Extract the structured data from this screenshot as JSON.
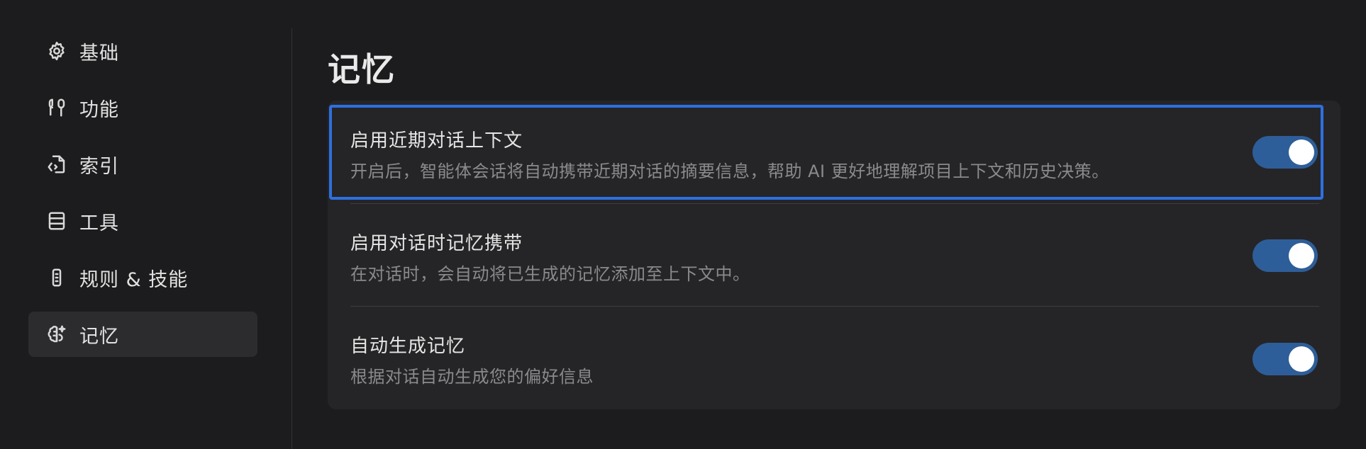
{
  "sidebar": {
    "items": [
      {
        "label": "基础",
        "icon": "gear-icon"
      },
      {
        "label": "功能",
        "icon": "tools-icon"
      },
      {
        "label": "索引",
        "icon": "index-file-icon"
      },
      {
        "label": "工具",
        "icon": "stack-icon"
      },
      {
        "label": "规则 & 技能",
        "icon": "rule-icon"
      },
      {
        "label": "记忆",
        "icon": "brain-sparkle-icon",
        "active": true
      }
    ]
  },
  "main": {
    "title": "记忆",
    "settings": [
      {
        "title": "启用近期对话上下文",
        "description": "开启后，智能体会话将自动携带近期对话的摘要信息，帮助 AI 更好地理解项目上下文和历史决策。",
        "enabled": true
      },
      {
        "title": "启用对话时记忆携带",
        "description": "在对话时，会自动将已生成的记忆添加至上下文中。",
        "enabled": true
      },
      {
        "title": "自动生成记忆",
        "description": "根据对话自动生成您的偏好信息",
        "enabled": true
      }
    ]
  },
  "colors": {
    "background": "#1c1c1e",
    "card": "#252527",
    "active_nav": "#2c2c2f",
    "toggle_on": "#2e5e99",
    "highlight_border": "#2f6fe0"
  }
}
